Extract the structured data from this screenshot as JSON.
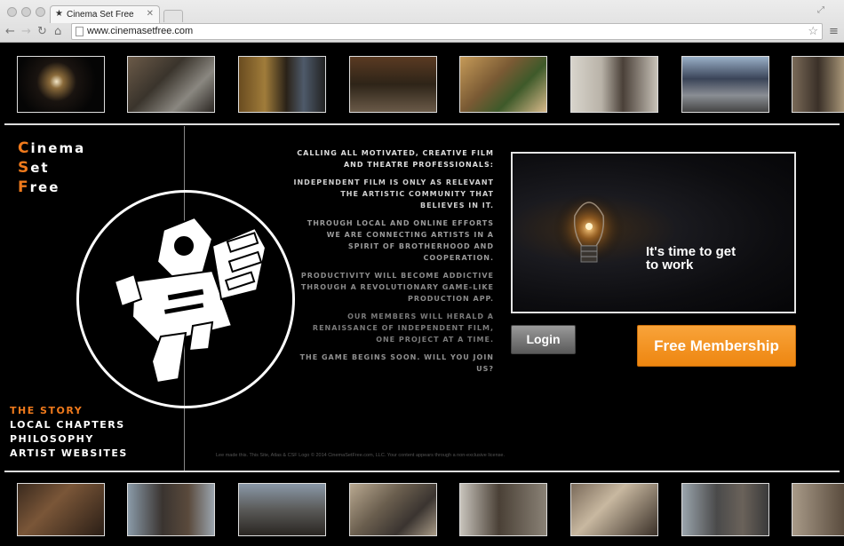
{
  "browser": {
    "tab_title": "Cinema Set Free",
    "url": "www.cinemasetfree.com"
  },
  "brand": {
    "line1_initial": "C",
    "line1_rest": "inema",
    "line2_initial": "S",
    "line2_rest": "et",
    "line3_initial": "F",
    "line3_rest": "ree"
  },
  "nav": {
    "items": [
      {
        "label": "The Story",
        "active": true
      },
      {
        "label": "Local Chapters",
        "active": false
      },
      {
        "label": "Philosophy",
        "active": false
      },
      {
        "label": "Artist Websites",
        "active": false
      }
    ]
  },
  "intro": {
    "paragraphs": [
      "Calling all motivated, creative film and theatre professionals:",
      "Independent Film is only as relevant the artistic community that believes in it.",
      "Through local and online efforts we are connecting artists in a spirit of brotherhood and cooperation.",
      "Productivity will become addictive through a revolutionary game-like production app.",
      "Our members will herald a renaissance of Independent Film, one project at a time.",
      "The game begins soon. Will you join us?"
    ]
  },
  "video": {
    "caption_line1": "It's time to get",
    "caption_line2": "to work"
  },
  "buttons": {
    "login": "Login",
    "free_membership": "Free Membership"
  },
  "footer": {
    "note": "Lee made this.  This Site, Atlas & CSF Logo © 2014 CinemaSetFree.com, LLC.  Your content appears through a non-exclusive license."
  },
  "colors": {
    "accent_orange": "#f07a1c",
    "background": "#000000"
  },
  "icons": [
    "back-icon",
    "forward-icon",
    "reload-icon",
    "home-icon",
    "star-icon",
    "menu-icon",
    "camera-logo-icon",
    "lightbulb-icon"
  ]
}
